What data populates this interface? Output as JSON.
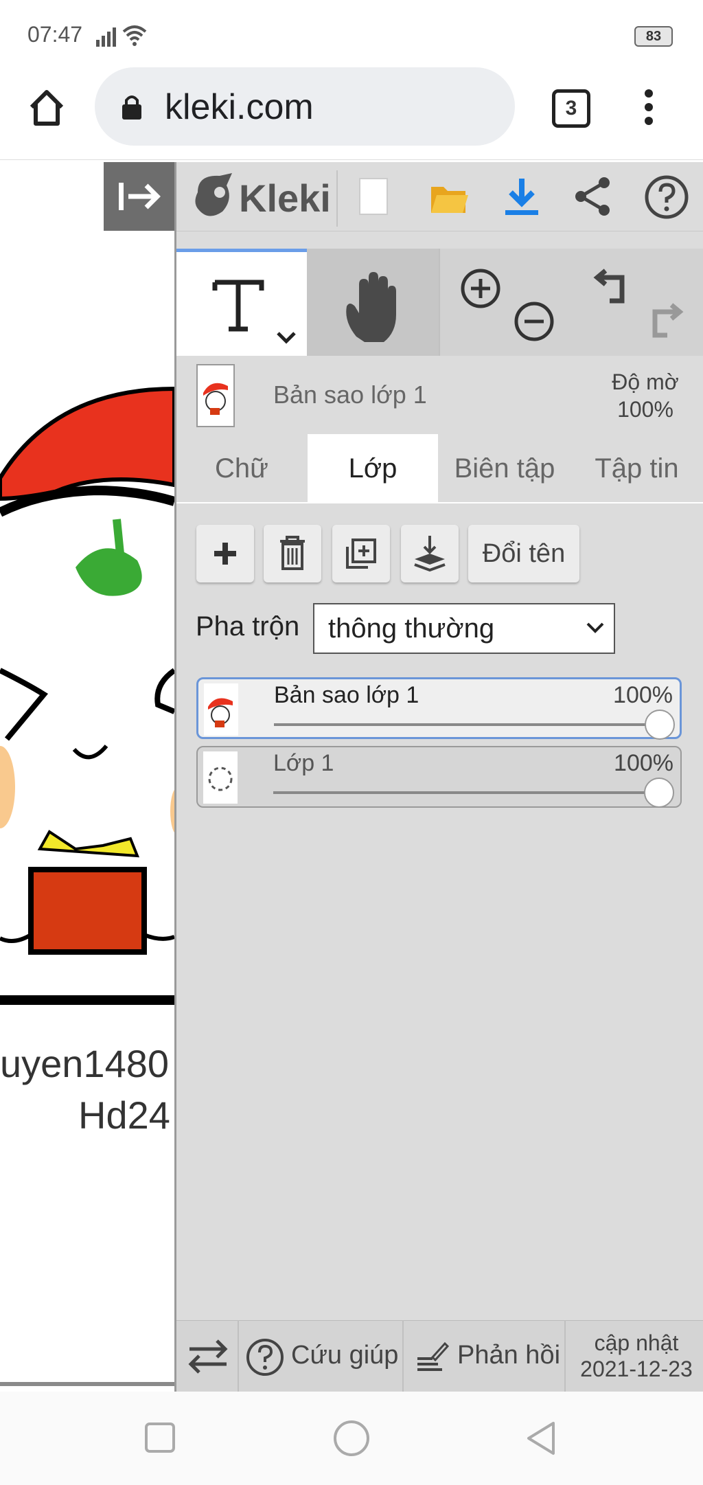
{
  "status_bar": {
    "time": "07:47",
    "battery": "83"
  },
  "browser": {
    "url": "kleki.com",
    "tab_count": "3"
  },
  "app": {
    "logo_text": "Kleki"
  },
  "canvas_text": {
    "line1": "uyen1480",
    "line2": "Hd24"
  },
  "layer_header": {
    "name": "Bản sao lớp 1",
    "opacity_label": "Độ mờ",
    "opacity_value": "100%"
  },
  "tabs": [
    "Chữ",
    "Lớp",
    "Biên tập",
    "Tập tin"
  ],
  "layer_actions": {
    "rename_label": "Đổi tên"
  },
  "blend": {
    "label": "Pha trộn",
    "value": "thông thường"
  },
  "layers": [
    {
      "name": "Bản sao lớp 1",
      "opacity": "100%",
      "opacity_level": 1.0
    },
    {
      "name": "Lớp 1",
      "opacity": "100%",
      "opacity_level": 1.0
    }
  ],
  "footer": {
    "help_label": "Cứu giúp",
    "feedback_label": "Phản hồi",
    "update_line1": "cập nhật",
    "update_line2": "2021-12-23"
  },
  "colors": {
    "accent": "#6a95d8",
    "download": "#1a7fe6",
    "folder": "#f2b632",
    "santa_red": "#e8321e",
    "leaf_green": "#3aaa35",
    "gift_red": "#d63a12",
    "gift_yellow": "#f2e82a"
  }
}
